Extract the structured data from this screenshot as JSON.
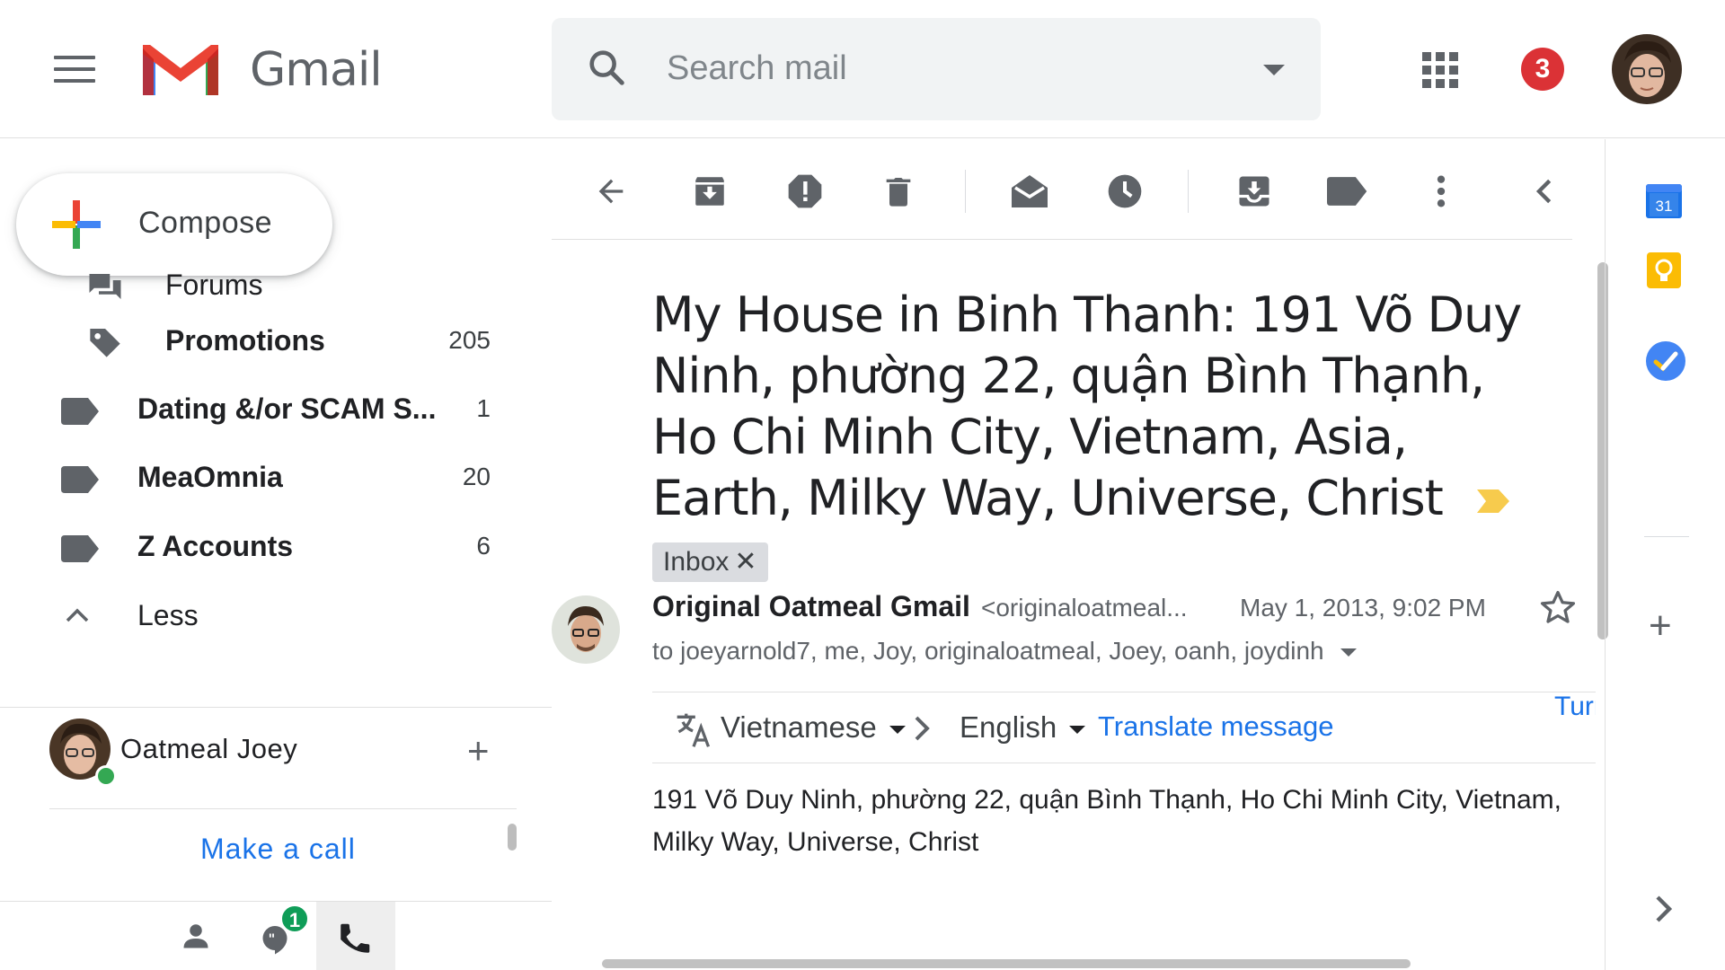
{
  "app": {
    "name": "Gmail"
  },
  "icons": {
    "menu": "hamburger-menu-icon",
    "search": "search-icon",
    "apps": "apps-grid-icon",
    "back": "arrow-back-icon",
    "archive": "archive-icon",
    "spam": "report-spam-icon",
    "delete": "trash-icon",
    "mark_unread": "mark-unread-icon",
    "snooze": "clock-icon",
    "move": "move-to-icon",
    "labels": "label-icon",
    "more": "more-vertical-icon",
    "collapse": "chevron-left-icon",
    "star": "star-icon",
    "translate": "translate-icon",
    "calendar": "calendar-icon",
    "keep": "keep-icon",
    "tasks": "tasks-icon"
  },
  "colors": {
    "accent_blue": "#1a73e8",
    "badge_red": "#db3236",
    "online_green": "#34a853",
    "important_yellow": "#f7cb4d"
  },
  "header": {
    "search_placeholder": "Search mail",
    "notification_count": "3"
  },
  "sidebar": {
    "compose_label": "Compose",
    "items": [
      {
        "label": "Forums",
        "count": ""
      },
      {
        "label": "Promotions",
        "count": "205"
      },
      {
        "label": "Dating &/or SCAM S...",
        "count": "1"
      },
      {
        "label": "MeaOmnia",
        "count": "20"
      },
      {
        "label": "Z Accounts",
        "count": "6"
      },
      {
        "label": "Less",
        "count": ""
      }
    ]
  },
  "hangouts": {
    "user_name": "Oatmeal Joey",
    "make_call": "Make a call",
    "chat_badge": "1"
  },
  "email": {
    "subject": "My House in Binh Thanh: 191 Võ Duy Ninh, phường 22, quận Bình Thạnh, Ho Chi Minh City, Vietnam, Asia, Earth, Milky Way, Universe, Christ",
    "label_chip": "Inbox",
    "sender_name": "Original Oatmeal Gmail",
    "sender_email": "<originaloatmeal...",
    "date": "May 1, 2013, 9:02 PM",
    "recipients": "to joeyarnold7, me, Joy, originaloatmeal, Joey, oanh, joydinh",
    "body": "191 Võ Duy Ninh, phường 22, quận Bình Thạnh, Ho Chi Minh City, Vietnam,\nMilky Way, Universe, Christ"
  },
  "translate": {
    "from_lang": "Vietnamese",
    "to_lang": "English",
    "action": "Translate message",
    "turn_off": "Turn off for: V"
  },
  "side_panel": {
    "calendar_day": "31"
  }
}
